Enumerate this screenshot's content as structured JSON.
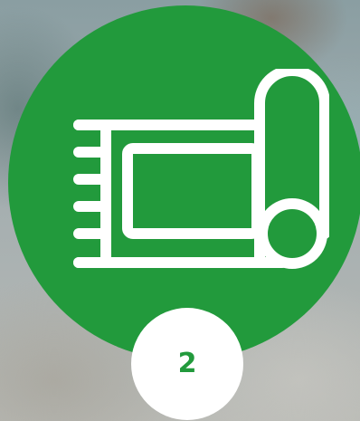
{
  "step": {
    "number": "2"
  },
  "icon": {
    "name": "rolled-rug-icon"
  },
  "colors": {
    "accent": "#229a3c",
    "icon_stroke": "#ffffff",
    "badge_background": "#ffffff",
    "number_text": "#229a3c"
  }
}
